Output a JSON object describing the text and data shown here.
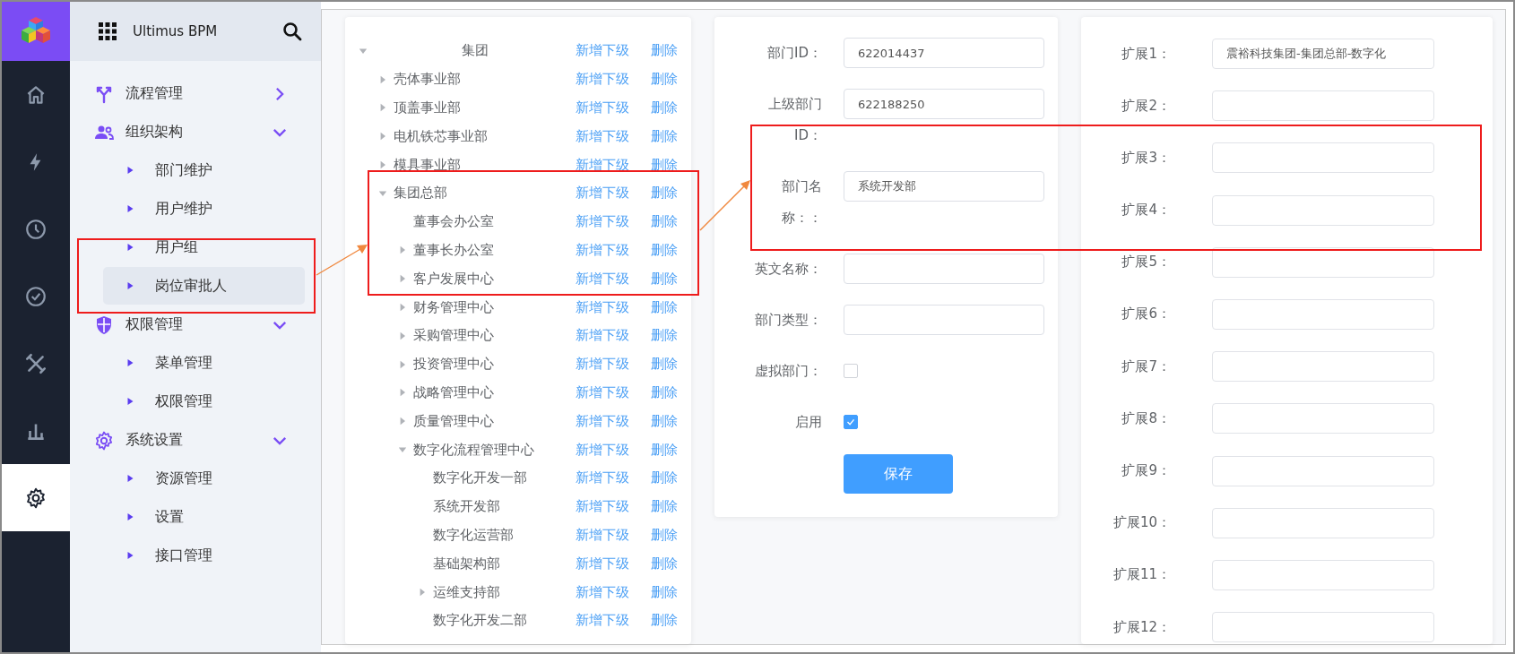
{
  "header": {
    "title": "Ultimus BPM"
  },
  "rail": [
    {
      "kind": "home",
      "selected": false
    },
    {
      "kind": "bolt",
      "selected": false
    },
    {
      "kind": "clock",
      "selected": false
    },
    {
      "kind": "check",
      "selected": false
    },
    {
      "kind": "tools",
      "selected": false
    },
    {
      "kind": "chart",
      "selected": false
    },
    {
      "kind": "gear",
      "selected": true
    }
  ],
  "nav": [
    {
      "kind": "flow",
      "label": "流程管理",
      "expanded": false
    },
    {
      "kind": "people",
      "label": "组织架构",
      "expanded": true,
      "children": [
        {
          "label": "部门维护",
          "selected": false
        },
        {
          "label": "用户维护",
          "selected": false
        },
        {
          "label": "用户组",
          "selected": false
        },
        {
          "label": "岗位审批人",
          "selected": true
        }
      ]
    },
    {
      "kind": "shield",
      "label": "权限管理",
      "expanded": true,
      "children": [
        {
          "label": "菜单管理",
          "selected": false
        },
        {
          "label": "权限管理",
          "selected": false
        }
      ]
    },
    {
      "kind": "gear",
      "label": "系统设置",
      "expanded": true,
      "children": [
        {
          "label": "资源管理",
          "selected": false
        },
        {
          "label": "设置",
          "selected": false
        },
        {
          "label": "接口管理",
          "selected": false
        }
      ]
    }
  ],
  "tree": [
    {
      "name": "集团",
      "kind": "branch",
      "expanded": true,
      "add": "新增下级",
      "delete": "删除",
      "children": [
        {
          "name": "壳体事业部",
          "kind": "branch",
          "expanded": false,
          "add": "新增下级",
          "delete": "删除"
        },
        {
          "name": "顶盖事业部",
          "kind": "branch",
          "expanded": false,
          "add": "新增下级",
          "delete": "删除"
        },
        {
          "name": "电机铁芯事业部",
          "kind": "branch",
          "expanded": false,
          "add": "新增下级",
          "delete": "删除"
        },
        {
          "name": "模具事业部",
          "kind": "branch",
          "expanded": false,
          "add": "新增下级",
          "delete": "删除"
        },
        {
          "name": "集团总部",
          "kind": "branch",
          "expanded": true,
          "add": "新增下级",
          "delete": "删除",
          "children": [
            {
              "name": "董事会办公室",
              "kind": "leaf",
              "add": "新增下级",
              "delete": "删除"
            },
            {
              "name": "董事长办公室",
              "kind": "branch",
              "expanded": false,
              "add": "新增下级",
              "delete": "删除"
            },
            {
              "name": "客户发展中心",
              "kind": "branch",
              "expanded": false,
              "add": "新增下级",
              "delete": "删除"
            },
            {
              "name": "财务管理中心",
              "kind": "branch",
              "expanded": false,
              "add": "新增下级",
              "delete": "删除"
            },
            {
              "name": "采购管理中心",
              "kind": "branch",
              "expanded": false,
              "add": "新增下级",
              "delete": "删除"
            },
            {
              "name": "投资管理中心",
              "kind": "branch",
              "expanded": false,
              "add": "新增下级",
              "delete": "删除"
            },
            {
              "name": "战略管理中心",
              "kind": "branch",
              "expanded": false,
              "add": "新增下级",
              "delete": "删除"
            },
            {
              "name": "质量管理中心",
              "kind": "branch",
              "expanded": false,
              "add": "新增下级",
              "delete": "删除"
            },
            {
              "name": "数字化流程管理中心",
              "kind": "branch",
              "expanded": true,
              "add": "新增下级",
              "delete": "删除",
              "children": [
                {
                  "name": "数字化开发一部",
                  "kind": "leaf",
                  "add": "新增下级",
                  "delete": "删除"
                },
                {
                  "name": "系统开发部",
                  "kind": "leaf",
                  "add": "新增下级",
                  "delete": "删除"
                },
                {
                  "name": "数字化运营部",
                  "kind": "leaf",
                  "add": "新增下级",
                  "delete": "删除"
                },
                {
                  "name": "基础架构部",
                  "kind": "leaf",
                  "add": "新增下级",
                  "delete": "删除"
                },
                {
                  "name": "运维支持部",
                  "kind": "branch",
                  "expanded": false,
                  "add": "新增下级",
                  "delete": "删除"
                },
                {
                  "name": "数字化开发二部",
                  "kind": "leaf",
                  "add": "新增下级",
                  "delete": "删除"
                }
              ]
            }
          ]
        }
      ]
    }
  ],
  "form": {
    "fields": [
      {
        "kind": "text",
        "label": "部门ID：",
        "value": "622014437"
      },
      {
        "kind": "text",
        "label": "上级部门ID：",
        "value": "622188250"
      },
      {
        "kind": "text",
        "label": "部门名称：：",
        "value": "系统开发部"
      },
      {
        "kind": "text",
        "label": "英文名称："
      },
      {
        "kind": "text",
        "label": "部门类型："
      },
      {
        "kind": "checkbox",
        "label": "虚拟部门：",
        "checked": false
      },
      {
        "kind": "checkbox",
        "label": "启用",
        "checked": true
      }
    ],
    "save_button": "保存"
  },
  "extensions": [
    {
      "label": "扩展1：",
      "value": "震裕科技集团-集团总部-数字化"
    },
    {
      "label": "扩展2："
    },
    {
      "label": "扩展3："
    },
    {
      "label": "扩展4："
    },
    {
      "label": "扩展5："
    },
    {
      "label": "扩展6："
    },
    {
      "label": "扩展7："
    },
    {
      "label": "扩展8："
    },
    {
      "label": "扩展9："
    },
    {
      "label": "扩展10："
    },
    {
      "label": "扩展11："
    },
    {
      "label": "扩展12："
    }
  ]
}
